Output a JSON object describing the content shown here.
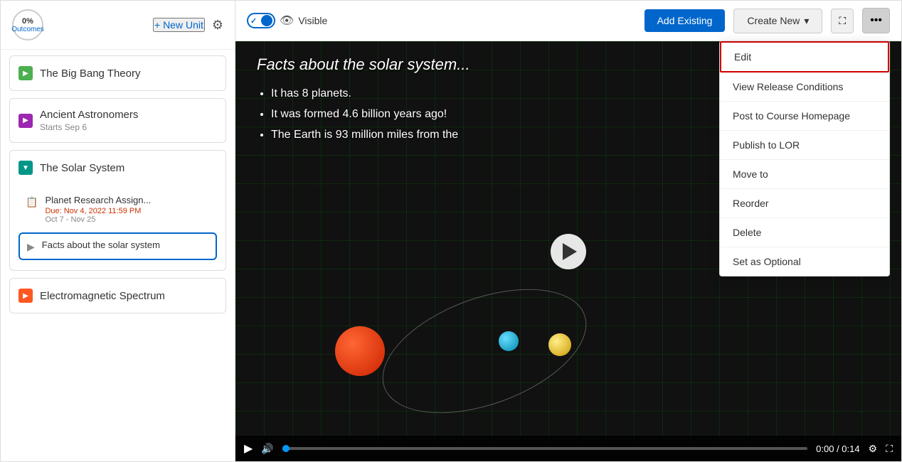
{
  "sidebar": {
    "header": {
      "outcomes_pct": "0%",
      "outcomes_label": "Outcomes",
      "new_unit_label": "+ New Unit"
    },
    "units": [
      {
        "id": "big-bang",
        "title": "The Big Bang Theory",
        "arrow_color": "green",
        "arrow_dir": "right",
        "expanded": false,
        "subtitle": ""
      },
      {
        "id": "ancient-astronomers",
        "title": "Ancient Astronomers",
        "arrow_color": "purple",
        "arrow_dir": "right",
        "expanded": false,
        "subtitle": "Starts Sep 6"
      },
      {
        "id": "solar-system",
        "title": "The Solar System",
        "arrow_color": "teal",
        "arrow_dir": "down",
        "expanded": true,
        "subtitle": ""
      }
    ],
    "children": [
      {
        "id": "planet-research",
        "icon": "📄",
        "title": "Planet Research Assign...",
        "due": "Due: Nov 4, 2022 11:59 PM",
        "dates": "Oct 7 - Nov 25",
        "active": false
      },
      {
        "id": "facts-video",
        "icon": "▶",
        "title": "Facts about the solar system",
        "due": "",
        "dates": "",
        "active": true
      }
    ],
    "extra_units": [
      {
        "id": "em-spectrum",
        "title": "Electromagnetic Spectrum",
        "arrow_color": "orange",
        "arrow_dir": "right",
        "expanded": false,
        "subtitle": ""
      }
    ]
  },
  "toolbar": {
    "toggle_state": "on",
    "visible_label": "Visible",
    "add_existing_label": "Add Existing",
    "create_new_label": "Create New"
  },
  "video": {
    "title_text": "Facts about the solar system...",
    "bullets": [
      "It has 8 planets.",
      "It was formed 4.6 billion years ago!",
      "The Earth is 93 million miles from the"
    ],
    "time_current": "0:00",
    "time_total": "0:14",
    "time_display": "0:00 / 0:14"
  },
  "dropdown_menu": {
    "items": [
      {
        "id": "edit",
        "label": "Edit",
        "highlighted": true
      },
      {
        "id": "view-release",
        "label": "View Release Conditions",
        "highlighted": false
      },
      {
        "id": "post-homepage",
        "label": "Post to Course Homepage",
        "highlighted": false
      },
      {
        "id": "publish-lor",
        "label": "Publish to LOR",
        "highlighted": false
      },
      {
        "id": "move-to",
        "label": "Move to",
        "highlighted": false
      },
      {
        "id": "reorder",
        "label": "Reorder",
        "highlighted": false
      },
      {
        "id": "delete",
        "label": "Delete",
        "highlighted": false
      },
      {
        "id": "set-optional",
        "label": "Set as Optional",
        "highlighted": false
      }
    ]
  },
  "icons": {
    "gear": "⚙",
    "eye": "👁",
    "play": "▶",
    "volume": "🔊",
    "settings": "⚙",
    "fullscreen_enter": "⛶",
    "more": "•••",
    "expand": "⛶"
  }
}
